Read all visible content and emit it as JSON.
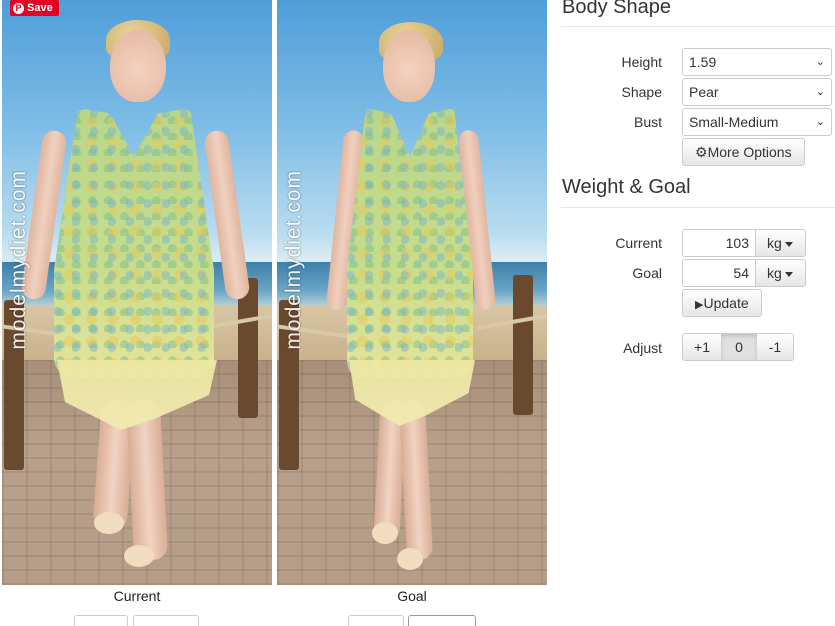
{
  "pin_save": {
    "label": "Save",
    "icon": "pinterest-icon"
  },
  "watermark": "modelmydiet.com",
  "models": {
    "current": {
      "caption": "Current"
    },
    "goal": {
      "caption": "Goal"
    }
  },
  "body_shape": {
    "title": "Body Shape",
    "height": {
      "label": "Height",
      "value": "1.59"
    },
    "shape": {
      "label": "Shape",
      "value": "Pear"
    },
    "bust": {
      "label": "Bust",
      "value": "Small-Medium"
    },
    "more_options": {
      "label": "More Options",
      "icon": "gear-icon"
    }
  },
  "weight_goal": {
    "title": "Weight & Goal",
    "current": {
      "label": "Current",
      "value": "103",
      "unit": "kg"
    },
    "goal": {
      "label": "Goal",
      "value": "54",
      "unit": "kg"
    },
    "update": {
      "label": "Update",
      "icon": "play-icon"
    }
  },
  "adjust": {
    "label": "Adjust",
    "options": [
      "+1",
      "0",
      "-1"
    ],
    "selected": "0"
  },
  "colors": {
    "pinterest_red": "#e60023",
    "border": "#cccccc"
  }
}
